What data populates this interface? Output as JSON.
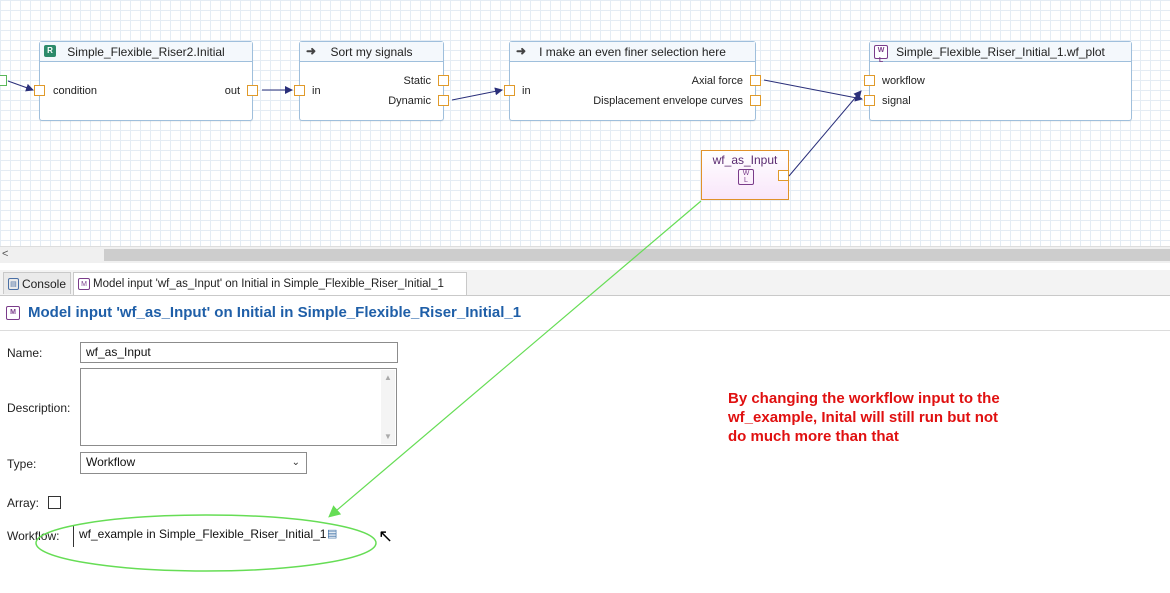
{
  "diagram": {
    "nodes": {
      "initial": {
        "title": "Simple_Flexible_Riser2.Initial",
        "badge": "R",
        "in_port": "condition",
        "out_port": "out"
      },
      "sort": {
        "title": "Sort my signals",
        "in_port": "in",
        "out_ports": [
          "Static",
          "Dynamic"
        ]
      },
      "finer": {
        "title": "I make an even finer selection here",
        "in_port": "in",
        "out_ports": [
          "Axial force",
          "Displacement envelope curves"
        ]
      },
      "plot": {
        "title": "Simple_Flexible_Riser_Initial_1.wf_plot",
        "in_ports": [
          "workflow",
          "signal"
        ]
      }
    },
    "wf_input": {
      "label": "wf_as_Input"
    }
  },
  "tabs": [
    {
      "label": "Console",
      "icon": "console-icon"
    },
    {
      "label": "Model input 'wf_as_Input' on Initial in Simple_Flexible_Riser_Initial_1",
      "icon": "model-input-icon"
    }
  ],
  "panel": {
    "title": "Model input 'wf_as_Input' on Initial in Simple_Flexible_Riser_Initial_1",
    "fields": {
      "name_label": "Name:",
      "name_value": "wf_as_Input",
      "description_label": "Description:",
      "description_value": "",
      "type_label": "Type:",
      "type_value": "Workflow",
      "array_label": "Array:",
      "workflow_label": "Workflow:",
      "workflow_value": "wf_example in Simple_Flexible_Riser_Initial_1"
    }
  },
  "annotation": {
    "lines": [
      "By changing the workflow input to the",
      "wf_example, Inital will still run but not",
      "do much more than that"
    ],
    "color": "#e01010"
  },
  "colors": {
    "accent": "#1f5fa8",
    "port": "#e09a2a",
    "node_border": "#9fbfdc",
    "highlight": "#66dd55"
  }
}
